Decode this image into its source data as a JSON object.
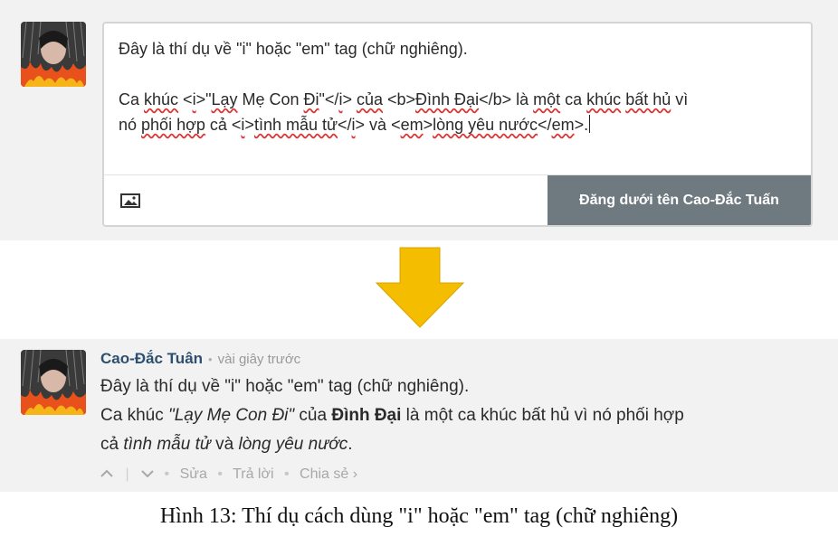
{
  "editor": {
    "line1": "Đây là thí dụ về \"i\" hoặc \"em\" tag (chữ nghiêng).",
    "line2": {
      "p1": "Ca ",
      "p2": "khúc",
      "p3": " <",
      "p4": "i",
      "p5": ">\"",
      "p6": "Lạy",
      "p7": " Mẹ Con ",
      "p8": "Đi",
      "p9": "\"</",
      "p10": "i",
      "p11": "> ",
      "p12": "của",
      "p13": " <b>",
      "p14": "Đình Đại",
      "p15": "</b> là ",
      "p16": "một",
      "p17": " ca ",
      "p18": "khúc",
      "p19": " ",
      "p20": "bất hủ",
      "p21": " vì"
    },
    "line3": {
      "p1": "nó ",
      "p2": "phối hợp",
      "p3": " cả <",
      "p4": "i",
      "p5": ">",
      "p6": "tình mẫu tử",
      "p7": "</",
      "p8": "i",
      "p9": "> và <",
      "p10": "em",
      "p11": ">",
      "p12": "lòng yêu nước",
      "p13": "</",
      "p14": "em",
      "p15": ">."
    }
  },
  "toolbar": {
    "image_icon": "image-icon",
    "post_button_label": "Đăng dưới tên Cao-Đắc Tuấn"
  },
  "arrow": {
    "icon": "arrow-down-icon",
    "color": "#f5bd00"
  },
  "comment": {
    "author": "Cao-Đắc Tuân",
    "separator": "•",
    "time": "vài giây trước",
    "line1": "Đây là thí dụ về \"i\" hoặc \"em\" tag (chữ nghiêng).",
    "line2": {
      "p1": "Ca khúc ",
      "p2": "\"Lạy Mẹ Con Đi\"",
      "p3": " của ",
      "p4": "Đình Đại",
      "p5": " là một ca khúc bất hủ vì nó phối hợp"
    },
    "line3": {
      "p1": "cả ",
      "p2": "tình mẫu tử",
      "p3": " và ",
      "p4": "lòng yêu nước",
      "p5": "."
    },
    "actions": {
      "upvote": "^",
      "divider": "|",
      "downvote": "v",
      "dot": "•",
      "edit": "Sửa",
      "reply": "Trả lời",
      "share": "Chia sẻ ›"
    }
  },
  "caption": "Hình 13: Thí dụ cách dùng \"i\" hoặc \"em\" tag (chữ nghiêng)",
  "colors": {
    "panel_bg": "#f2f2f2",
    "button_bg": "#6f7980",
    "author": "#2e4f6e",
    "arrow": "#f5bd00"
  }
}
